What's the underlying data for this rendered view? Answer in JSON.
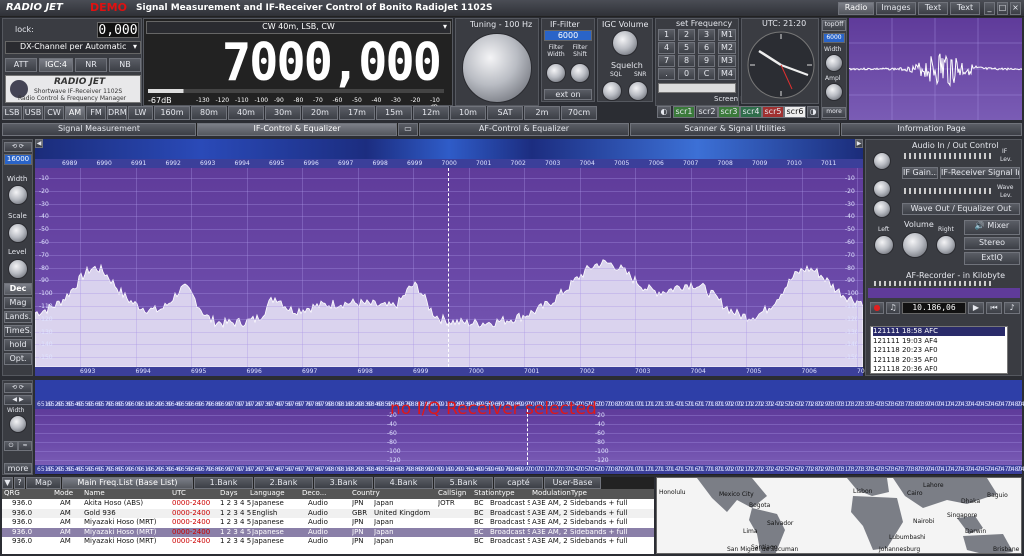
{
  "title": {
    "brand": "RADIO JET",
    "demo": "DEMO",
    "text": "Signal Measurement and IF-Receiver Control of Bonito RadioJet 1102S"
  },
  "top_tabs": [
    "Radio",
    "Images",
    "Text",
    "Text"
  ],
  "lock": {
    "label": "lock:",
    "value": "0,000"
  },
  "channel_select": "DX-Channel per Automatic",
  "mode_select": "CW 40m, LSB, CW",
  "agc_buttons": [
    "ATT",
    "IGC:4",
    "NR",
    "NB"
  ],
  "logo": {
    "line1": "Shortwave IF-Receiver 1102S",
    "line2": "Radio Control & Frequency Manager"
  },
  "frequency": "7000,000",
  "smeter": {
    "value": "-67dB",
    "scale": [
      "-130",
      "-120",
      "-110",
      "-100",
      "-90",
      "-80",
      "-70",
      "-60",
      "-50",
      "-40",
      "-30",
      "-20",
      "-10 dB"
    ]
  },
  "tuning": {
    "label": "Tuning - 100 Hz"
  },
  "if_filter": {
    "label": "IF-Filter",
    "value": "6000",
    "width": "Filter Width",
    "shift": "Filter Shift",
    "ext": "ext on"
  },
  "igc": {
    "label": "IGC Volume",
    "squelch": "Squelch",
    "sql": "SQL",
    "snr": "SNR"
  },
  "set_frequency": {
    "label": "set Frequency",
    "keys": [
      "1",
      "2",
      "3",
      "M1",
      "4",
      "5",
      "6",
      "M2",
      "7",
      "8",
      "9",
      "M3",
      ".",
      "0",
      "C",
      "M4"
    ]
  },
  "screen_design": {
    "label": "Screen Design",
    "buttons": [
      "scr1",
      "scr2",
      "scr3",
      "scr4",
      "scr5",
      "scr6"
    ]
  },
  "clock": {
    "label": "UTC: 21:20"
  },
  "right_ctrl": {
    "top": "topOff",
    "value": "6000",
    "width": "Width",
    "ampl": "Ampl",
    "more": "more"
  },
  "bands": [
    "LSB",
    "USB",
    "CW",
    "AM",
    "FM",
    "DRM",
    "LW",
    "160m",
    "80m",
    "40m",
    "30m",
    "20m",
    "17m",
    "15m",
    "12m",
    "10m",
    "SAT",
    "2m",
    "70cm"
  ],
  "section_tabs": [
    "Signal Measurement",
    "IF-Control & Equalizer",
    "AF-Control & Equalizer",
    "Scanner & Signal Utilities",
    "Information Page"
  ],
  "spectrum": {
    "top_ticks": [
      "6989",
      "6990",
      "6991",
      "6992",
      "6993",
      "6994",
      "6995",
      "6996",
      "6997",
      "6998",
      "6999",
      "7000",
      "7001",
      "7002",
      "7003",
      "7004",
      "7005",
      "7006",
      "7007",
      "7008",
      "7009",
      "7010",
      "7011"
    ],
    "db_ticks": [
      "-10",
      "-20",
      "-30",
      "-40",
      "-50",
      "-60",
      "-70",
      "-80",
      "-90",
      "-100",
      "-110",
      "-120",
      "-130",
      "-140",
      "-150"
    ],
    "bottom_ticks": [
      "6993",
      "6994",
      "6995",
      "6996",
      "6997",
      "6998",
      "6999",
      "7000",
      "7001",
      "7002",
      "7003",
      "7004",
      "7005",
      "7006",
      "7007"
    ]
  },
  "left_ctrl": {
    "value": "16000",
    "width": "Width",
    "scale": "Scale",
    "level": "Level",
    "buttons": [
      "Dec",
      "Mag",
      "Lands.",
      "TimeS.",
      "hold",
      "Opt."
    ]
  },
  "audio": {
    "title": "Audio In / Out Control",
    "if": "IF",
    "lev": "Lev.",
    "if_gain": "IF Gain...",
    "if_signal": "IF-Receiver Signal In",
    "wave": "Wave",
    "wave_out": "Wave Out / Equalizer Out",
    "mixer": "Mixer",
    "left": "Left",
    "volume": "Volume",
    "right": "Right",
    "stereo": "Stereo",
    "extq": "ExtIQ",
    "recorder": "AF-Recorder - in Kilobyte",
    "counter": "10.186,06",
    "files": [
      "121111 18:58 AFC",
      "121111 19:03 AF4",
      "121118 20:23 AF0",
      "121118 20:35 AF0",
      "121118 20:36 AF0"
    ]
  },
  "iq": {
    "message": "no I/Q Receiver selected",
    "ticks": [
      "6510",
      "6520",
      "6530",
      "6540",
      "6550",
      "6560",
      "6570",
      "6580",
      "6590",
      "6600",
      "6610",
      "6620",
      "6630",
      "6640",
      "6650",
      "6660",
      "6670",
      "6680",
      "6690",
      "6700",
      "6710",
      "6720",
      "6730",
      "6740",
      "6750",
      "6760",
      "6770",
      "6780",
      "6790",
      "6800",
      "6810",
      "6820",
      "6830",
      "6840",
      "6850",
      "6860",
      "6870",
      "6880",
      "6890",
      "6900",
      "6910",
      "6920",
      "6930",
      "6940",
      "6950",
      "6960",
      "6970",
      "6980",
      "6990",
      "7000",
      "7010",
      "7020",
      "7030",
      "7040",
      "7050",
      "7060",
      "7070",
      "7080",
      "7090",
      "7100",
      "7110",
      "7120",
      "7130",
      "7140",
      "7150",
      "7160",
      "7170",
      "7180",
      "7190",
      "7200",
      "7210",
      "7220",
      "7230",
      "7240",
      "7250",
      "7260",
      "7270",
      "7280",
      "7290",
      "7300",
      "7310",
      "7320",
      "7330",
      "7340",
      "7350",
      "7360",
      "7370",
      "7380",
      "7390",
      "7400",
      "7410",
      "7420",
      "7430",
      "7440",
      "7450",
      "7460",
      "7470",
      "7480",
      "7490"
    ],
    "db": [
      "-20",
      "-40",
      "-60",
      "-80",
      "-100",
      "-120"
    ],
    "width": "Width",
    "more": "more"
  },
  "freqlist": {
    "tabs": [
      "Map",
      "Main Freq.List (Base List)",
      "1.Bank",
      "2.Bank",
      "3.Bank",
      "4.Bank",
      "5.Bank",
      "capté",
      "User-Base"
    ],
    "columns": [
      "QRG",
      "Mode",
      "Name",
      "UTC",
      "Days",
      "Language",
      "Deco...",
      "Country",
      "CallSign",
      "Stationtype",
      "ModulationType"
    ],
    "rows": [
      [
        "936.0",
        "AM",
        "Akita Hoso (ABS)",
        "0000-2400",
        "1 2 3 4 5 6 7",
        "Japanese",
        "Audio",
        "JPN",
        "Japan",
        "JOTR",
        "BC",
        "Broadcast Station",
        "A3E",
        "AM, 2 Sidebands + full"
      ],
      [
        "936.0",
        "AM",
        "Gold 936",
        "0000-2400",
        "1 2 3 4 5 6 7",
        "English",
        "Audio",
        "GBR",
        "United Kingdom",
        "",
        "BC",
        "Broadcast Station",
        "A3E",
        "AM, 2 Sidebands + full"
      ],
      [
        "936.0",
        "AM",
        "Miyazaki Hoso (MRT)",
        "0000-2400",
        "1 2 3 4 5 6 7",
        "Japanese",
        "Audio",
        "JPN",
        "Japan",
        "",
        "BC",
        "Broadcast Station",
        "A3E",
        "AM, 2 Sidebands + full"
      ],
      [
        "936.0",
        "AM",
        "Miyazaki Hoso (MRT)",
        "0000-2400",
        "1 2 3 4 5 6 7",
        "Japanese",
        "Audio",
        "JPN",
        "Japan",
        "",
        "BC",
        "Broadcast Station",
        "A3E",
        "AM, 2 Sidebands + full"
      ],
      [
        "936.0",
        "AM",
        "Miyazaki Hoso (MRT)",
        "0000-2400",
        "1 2 3 4 5 6 7",
        "Japanese",
        "Audio",
        "JPN",
        "Japan",
        "",
        "BC",
        "Broadcast Station",
        "A3E",
        "AM, 2 Sidebands + full"
      ]
    ]
  },
  "map": {
    "places": [
      "Honolulu",
      "Mexico City",
      "Bogota",
      "Salvador",
      "Lima",
      "Santiago",
      "San Miguel de Tucuman",
      "Lisbon",
      "Cairo",
      "Nairobi",
      "Lubumbashi",
      "Johannesburg",
      "Lahore",
      "Dhaka",
      "Baguio",
      "Singapore",
      "Darwin",
      "Brisbane"
    ]
  }
}
